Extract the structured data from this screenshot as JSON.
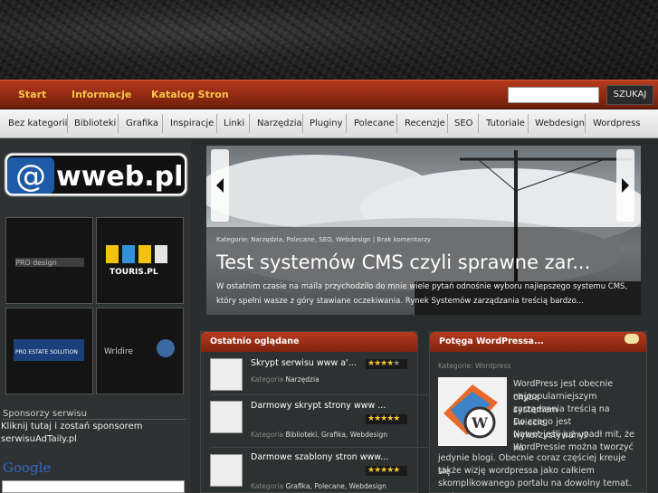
{
  "topnav": {
    "items": [
      "Start",
      "Informacje",
      "Katalog Stron"
    ],
    "search_button": "SZUKAJ"
  },
  "categories": [
    "Bez kategorii",
    "Biblioteki",
    "Grafika",
    "Inspiracje",
    "Linki",
    "Narzędzia",
    "Pluginy",
    "Polecane",
    "Recenzje",
    "SEO",
    "Tutoriale",
    "Webdesign",
    "Wordpress"
  ],
  "logo": {
    "text": "wweb.pl",
    "glyph": "@"
  },
  "thumbs": [
    "PRO design",
    "TOURIS.PL",
    "PRO ESTATE SOLUTION",
    "Wrldire"
  ],
  "sponsors": {
    "heading": "Sponsorzy serwisu",
    "line1": "Kliknij tutaj i zostań sponsorem",
    "line2": "serwisuAdTaily.pl"
  },
  "google": "Google",
  "slider": {
    "meta": "Kategorie: Narzędzia, Polecane, SEO, Webdesign | Brak komentarzy",
    "title": "Test systemów CMS czyli sprawne zar...",
    "excerpt": "W ostatnim czasie na maila przychodziło do mnie wiele pytań odnośnie wyboru najlepszego systemu CMS, który spełni wasze z góry stawiane oczekiwania. Rynek Systemów zarządzania treścią bardzo..."
  },
  "recent": {
    "heading": "Ostatnio oglądane",
    "category_label": "Kategoria",
    "items": [
      {
        "title": "Skrypt serwisu www a'...",
        "cats": "Narzędzia",
        "rating": 4
      },
      {
        "title": "Darmowy skrypt strony www ...",
        "cats": "Biblioteki, Grafika, Webdesign",
        "rating": 5
      },
      {
        "title": "Darmowe szablony stron www...",
        "cats": "Grafika, Polecane, Webdesign",
        "rating": 5
      }
    ]
  },
  "wordpress": {
    "heading": "Potęga WordPressa...",
    "category": "Kategorie: Wordpress",
    "lines": [
      "WordPress jest obecnie chyba",
      "najpopularniejszym systemem",
      "zarządzania treścią na świecie.",
      "Do czego jest wykorzystywany?",
      "Nawet jeśli już upadł mit, że na",
      "WordPressie można tworzyć",
      "jedynie blogi. Obecnie coraz częściej kreuje się",
      "także wizję wordpressa jako całkiem",
      "skomplikowanego portalu na dowolny temat. Może"
    ]
  }
}
